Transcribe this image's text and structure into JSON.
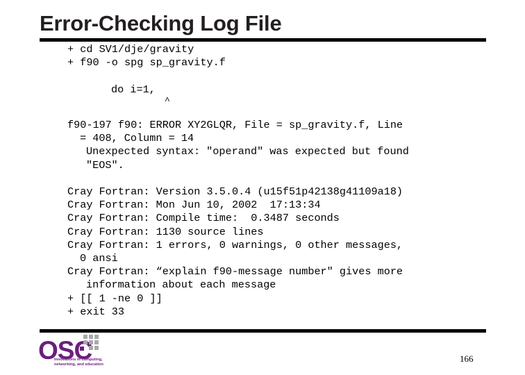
{
  "slide": {
    "title": "Error-Checking Log File",
    "page_number": "166"
  },
  "log": {
    "lines": [
      {
        "text": "+ cd SV1/dje/gravity",
        "indent": 0,
        "kind": "text"
      },
      {
        "text": "+ f90 -o spg sp_gravity.f",
        "indent": 0,
        "kind": "text"
      },
      {
        "text": "",
        "indent": 0,
        "kind": "blank"
      },
      {
        "text": "do i=1,",
        "indent": 3,
        "kind": "text"
      },
      {
        "text": "^",
        "indent": 0,
        "kind": "caret"
      },
      {
        "text": "",
        "indent": 0,
        "kind": "blank"
      },
      {
        "text": "f90-197 f90: ERROR XY2GLQR, File = sp_gravity.f, Line",
        "indent": 0,
        "kind": "text"
      },
      {
        "text": "= 408, Column = 14",
        "indent": 1,
        "kind": "text"
      },
      {
        "text": "Unexpected syntax: \"operand\" was expected but found",
        "indent": 2,
        "kind": "text"
      },
      {
        "text": "\"EOS\".",
        "indent": 2,
        "kind": "text"
      },
      {
        "text": "",
        "indent": 0,
        "kind": "blank"
      },
      {
        "text": "Cray Fortran: Version 3.5.0.4 (u15f51p42138g41109a18)",
        "indent": 0,
        "kind": "text"
      },
      {
        "text": "Cray Fortran: Mon Jun 10, 2002  17:13:34",
        "indent": 0,
        "kind": "text"
      },
      {
        "text": "Cray Fortran: Compile time:  0.3487 seconds",
        "indent": 0,
        "kind": "text"
      },
      {
        "text": "Cray Fortran: 1130 source lines",
        "indent": 0,
        "kind": "text"
      },
      {
        "text": "Cray Fortran: 1 errors, 0 warnings, 0 other messages,",
        "indent": 0,
        "kind": "text"
      },
      {
        "text": "0 ansi",
        "indent": 1,
        "kind": "text"
      },
      {
        "text": "Cray Fortran: “explain f90-message number\" gives more",
        "indent": 0,
        "kind": "text"
      },
      {
        "text": "information about each message",
        "indent": 2,
        "kind": "text"
      },
      {
        "text": "+ [[ 1 -ne 0 ]]",
        "indent": 0,
        "kind": "text"
      },
      {
        "text": "+ exit 33",
        "indent": 0,
        "kind": "text"
      }
    ]
  },
  "logo": {
    "wordmark": "OSC",
    "tagline_line1": "Innovations in computing,",
    "tagline_line2": "networking, and education",
    "color": "#6b1f7c",
    "grid_color": "#a7a9ac"
  }
}
